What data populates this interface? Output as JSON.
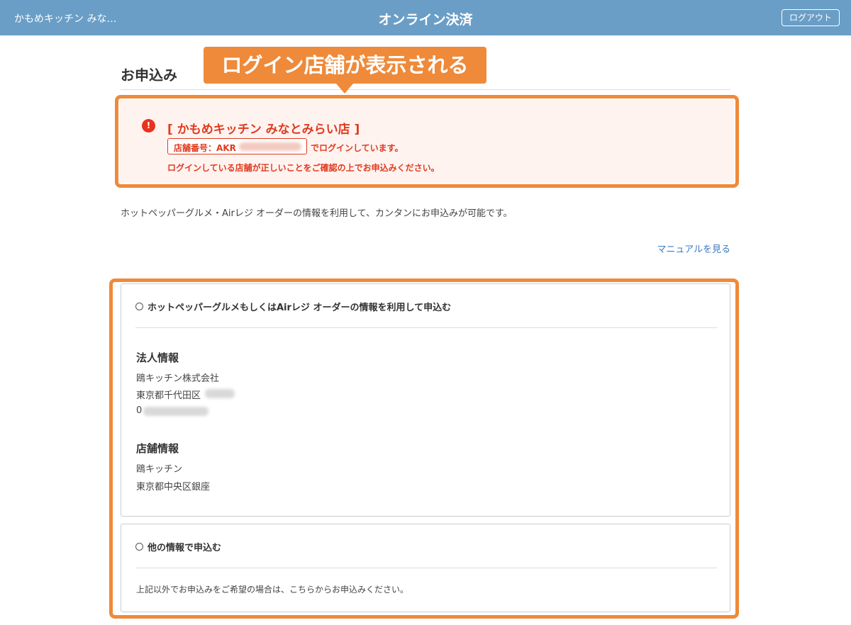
{
  "header": {
    "store_short": "かもめキッチン みな…",
    "title": "オンライン決済",
    "logout_label": "ログアウト"
  },
  "page": {
    "heading": "お申込み"
  },
  "callout": {
    "text": "ログイン店舗が表示される"
  },
  "alert": {
    "icon": "!",
    "store_name": "[ かもめキッチン みなとみらい店 ]",
    "store_no_label": "店舗番号：AKR",
    "line1": "でログインしています。",
    "line2": "ログインしている店舗が正しいことをご確認の上でお申込みください。"
  },
  "intro": "ホットペッパーグルメ・Airレジ オーダーの情報を利用して、カンタンにお申込みが可能です。",
  "manual_link": "マニュアルを見る",
  "option1": {
    "label": "ホットペッパーグルメもしくはAirレジ オーダーの情報を利用して申込む",
    "corp_title": "法人情報",
    "corp_name": "鴎キッチン株式会社",
    "corp_address": "東京都千代田区",
    "corp_phone": "0",
    "store_title": "店舗情報",
    "store_name": "鴎キッチン",
    "store_address": "東京都中央区銀座"
  },
  "option2": {
    "label": "他の情報で申込む",
    "description": "上記以外でお申込みをご希望の場合は、こちらからお申込みください。"
  },
  "colors": {
    "header_bg": "#6a9ec6",
    "highlight": "#ee8a3a",
    "alert_text": "#e03a1e",
    "alert_bg": "#fff3f0",
    "link": "#3a7cc0"
  }
}
